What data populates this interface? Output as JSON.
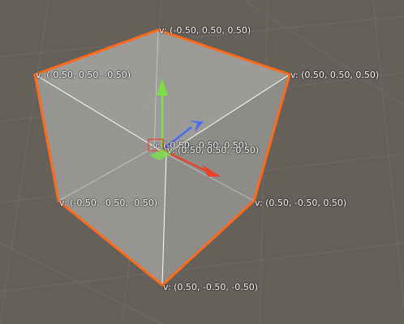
{
  "colors": {
    "background": "#66605b",
    "grid": "#7a736e",
    "cube_face": "#b8b8b6",
    "selection_outline": "#ff6a1a",
    "axis_x": "#e8432a",
    "axis_y": "#7be046",
    "axis_z": "#4a6cf0",
    "label_text": "#ffffff"
  },
  "vertices": {
    "top_back": "v: (-0.50, 0.50, 0.50)",
    "top_left": "v: (-0.50, 0.50, -0.50)",
    "top_right": "v: (0.50, 0.50, 0.50)",
    "hidden_back_bottom": "v: (-0.50, -0.50, 0.50)",
    "center_overlap": "v: (0.50, 0.50, -0.50)",
    "bottom_left": "v: (-0.50, -0.50, -0.50)",
    "bottom_right": "v: (0.50, -0.50, 0.50)",
    "bottom_front": "v: (0.50, -0.50, -0.50)"
  },
  "icons": {
    "move_gizmo": "move-gizmo-icon",
    "x_arrow": "x-axis-arrow-icon",
    "y_arrow": "y-axis-arrow-icon",
    "z_arrow": "z-axis-arrow-icon",
    "plane_handle": "plane-handle-icon"
  }
}
